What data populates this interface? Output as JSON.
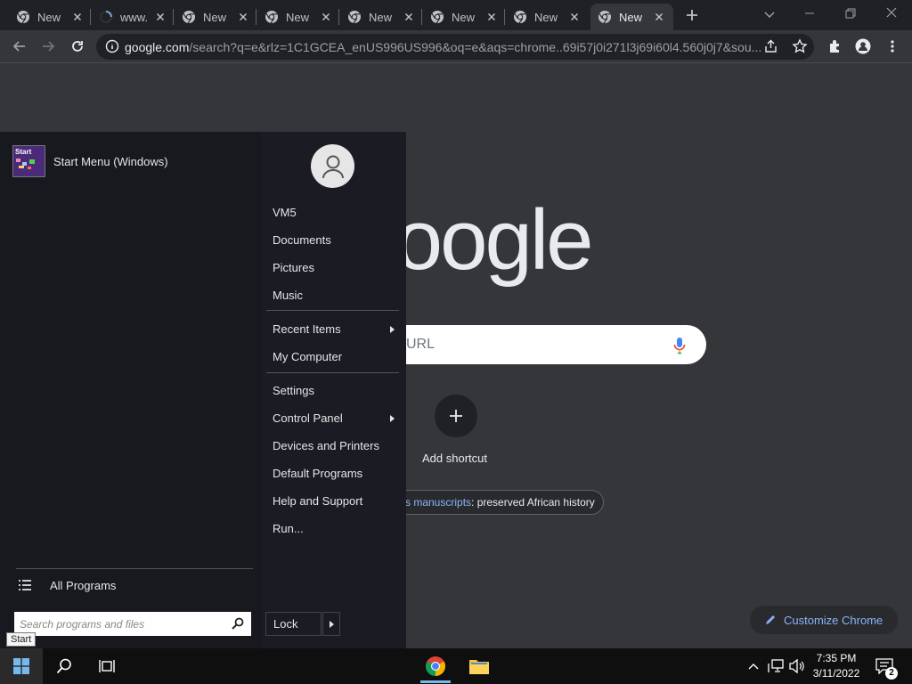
{
  "browser": {
    "tabs": [
      {
        "title": "New",
        "loading": false
      },
      {
        "title": "www.",
        "loading": true
      },
      {
        "title": "New",
        "loading": false
      },
      {
        "title": "New",
        "loading": false
      },
      {
        "title": "New",
        "loading": false
      },
      {
        "title": "New",
        "loading": false
      },
      {
        "title": "New",
        "loading": false
      },
      {
        "title": "New",
        "loading": false,
        "active": true
      }
    ],
    "url_domain": "google.com",
    "url_rest": "/search?q=e&rlz=1C1GCEA_enUS996US996&oq=e&aqs=chrome..69i57j0i271l3j69i60l4.560j0j7&sou..."
  },
  "page": {
    "logo_text": "Google",
    "search_placeholder": "URL",
    "add_shortcut_label": "Add shortcut",
    "promo_link": "s manuscripts",
    "promo_text": ": preserved African history",
    "customize_label": "Customize Chrome"
  },
  "start_menu": {
    "logo_text": "Start",
    "title": "Start Menu (Windows)",
    "items_group1": [
      "VM5",
      "Documents",
      "Pictures",
      "Music"
    ],
    "items_group2": [
      {
        "label": "Recent Items",
        "submenu": true
      },
      {
        "label": "My Computer",
        "submenu": false
      }
    ],
    "items_group3": [
      {
        "label": "Settings",
        "submenu": false
      },
      {
        "label": "Control Panel",
        "submenu": true
      },
      {
        "label": "Devices and Printers",
        "submenu": false
      },
      {
        "label": "Default Programs",
        "submenu": false
      },
      {
        "label": "Help and Support",
        "submenu": false
      },
      {
        "label": "Run...",
        "submenu": false
      }
    ],
    "all_programs": "All Programs",
    "search_placeholder": "Search programs and files",
    "lock_label": "Lock",
    "tooltip": "Start"
  },
  "taskbar": {
    "time": "7:35 PM",
    "date": "3/11/2022",
    "notification_count": "2"
  },
  "colors": {
    "accent": "#8ab4f8",
    "taskbar": "#0f0f0f",
    "start_menu": "#1b1b24"
  }
}
